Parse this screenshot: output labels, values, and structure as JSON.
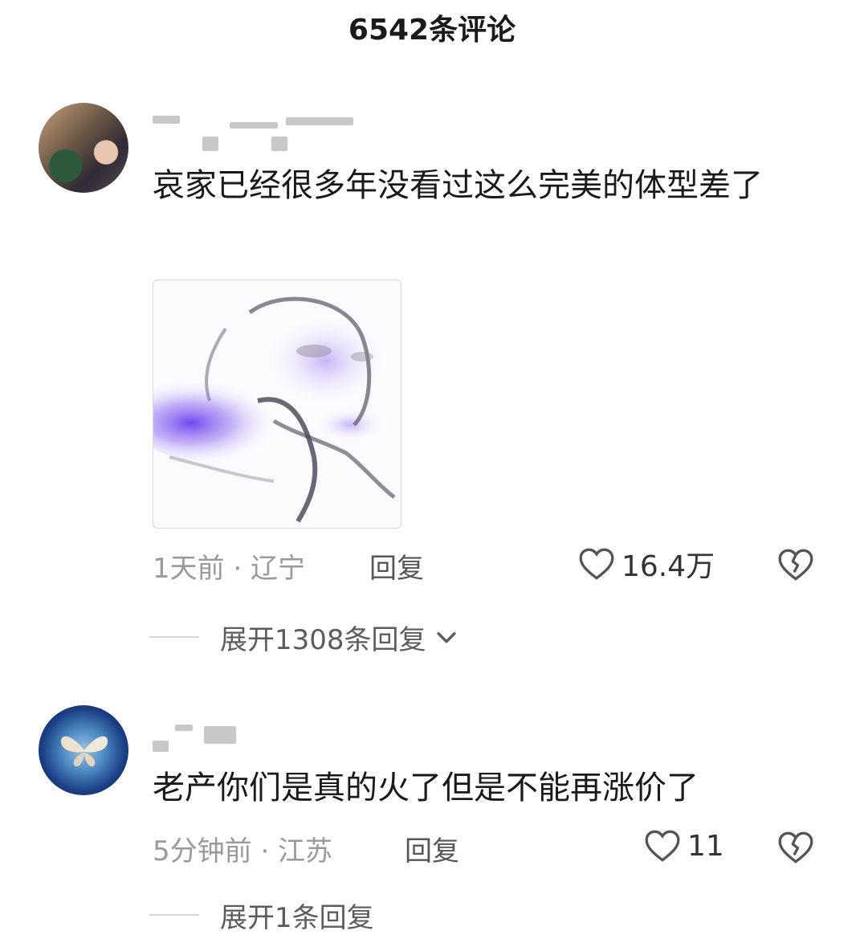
{
  "header": {
    "title": "6542条评论"
  },
  "comments": [
    {
      "text": "哀家已经很多年没看过这么完美的体型差了",
      "time_location": "1天前 · 辽宁",
      "reply_label": "回复",
      "likes": "16.4万",
      "expand_label": "展开1308条回复"
    },
    {
      "text": "老产你们是真的火了但是不能再涨价了",
      "time_location": "5分钟前 · 江苏",
      "reply_label": "回复",
      "likes": "11",
      "expand_label": "展开1条回复"
    }
  ],
  "colors": {
    "meta_gray": "#9a9a9a",
    "sticker_purple": "#6a3df0"
  },
  "icons": [
    "heart-icon",
    "broken-heart-icon",
    "chevron-down-icon"
  ]
}
